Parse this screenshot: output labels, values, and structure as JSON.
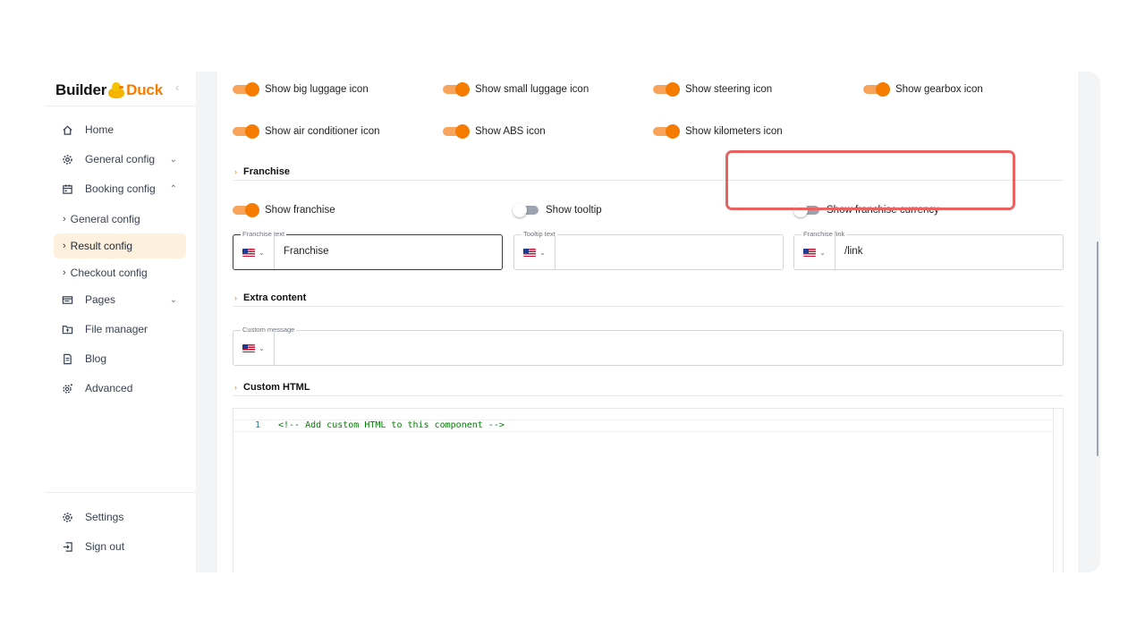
{
  "sidebar": {
    "logo_left": "Builder",
    "logo_right": "Duck",
    "collapse_icon": "‹",
    "items": [
      {
        "label": "Home",
        "icon": "home-icon"
      },
      {
        "label": "General config",
        "icon": "gear-icon",
        "chevron": "⌄"
      },
      {
        "label": "Booking config",
        "icon": "calendar-icon",
        "chevron": "⌃"
      },
      {
        "label": "Pages",
        "icon": "pages-icon",
        "chevron": "⌄"
      },
      {
        "label": "File manager",
        "icon": "folder-icon"
      },
      {
        "label": "Blog",
        "icon": "document-icon"
      },
      {
        "label": "Advanced",
        "icon": "advanced-gear-icon"
      }
    ],
    "sub_items": [
      {
        "label": "General config"
      },
      {
        "label": "Result config",
        "active": true
      },
      {
        "label": "Checkout config"
      }
    ],
    "bottom_items": [
      {
        "label": "Settings",
        "icon": "settings-icon"
      },
      {
        "label": "Sign out",
        "icon": "sign-out-icon"
      }
    ]
  },
  "main": {
    "icon_toggles_row1": [
      {
        "label": "Show big luggage icon",
        "on": true
      },
      {
        "label": "Show small luggage icon",
        "on": true
      },
      {
        "label": "Show steering icon",
        "on": true
      },
      {
        "label": "Show gearbox icon",
        "on": true
      }
    ],
    "icon_toggles_row2": [
      {
        "label": "Show air conditioner icon",
        "on": true
      },
      {
        "label": "Show ABS icon",
        "on": true
      },
      {
        "label": "Show kilometers icon",
        "on": true
      }
    ],
    "franchise_section": {
      "title": "Franchise",
      "toggles": [
        {
          "label": "Show franchise",
          "on": true
        },
        {
          "label": "Show tooltip",
          "on": false
        },
        {
          "label": "Show franchise currency",
          "on": false
        }
      ],
      "fields": [
        {
          "label": "Franchise text",
          "value": "Franchise"
        },
        {
          "label": "Tooltip text",
          "value": ""
        },
        {
          "label": "Franchise link",
          "value": "/link"
        }
      ]
    },
    "extra_section": {
      "title": "Extra content",
      "field": {
        "label": "Custom message",
        "value": ""
      }
    },
    "html_section": {
      "title": "Custom HTML",
      "line_number": "1",
      "code": "<!-- Add custom HTML to this component -->"
    }
  },
  "colors": {
    "accent": "#f57c00",
    "active_bg": "#fdf0dc",
    "highlight": "#e86262"
  }
}
